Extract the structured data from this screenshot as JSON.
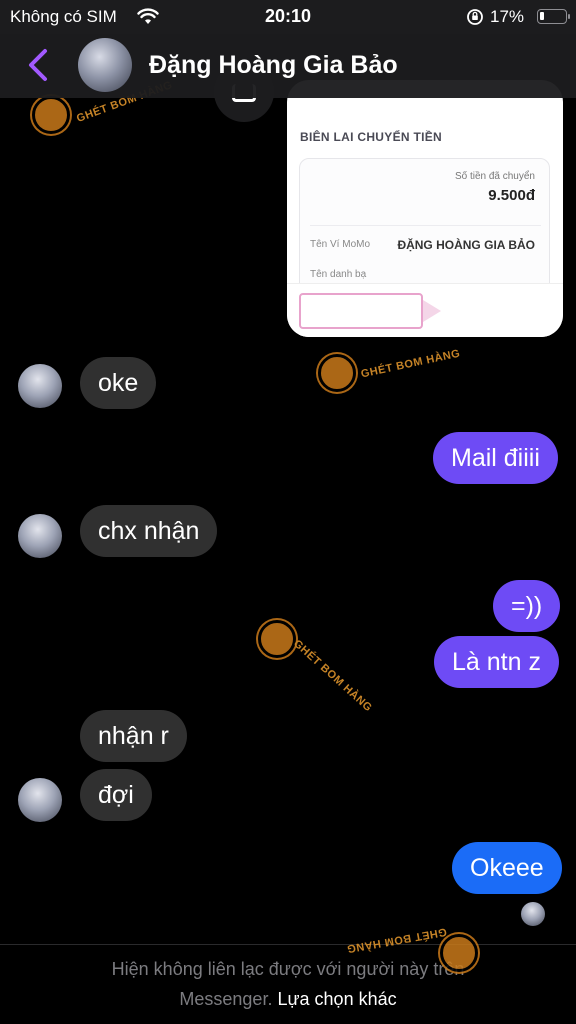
{
  "status_bar": {
    "carrier": "Không có SIM",
    "time": "20:10",
    "battery_pct": "17%",
    "battery_level": 0.17
  },
  "header": {
    "title": "Đặng Hoàng Gia Bảo",
    "back_icon": "chevron-left-icon",
    "accent_color": "#a259ff"
  },
  "shared_receipt": {
    "heading": "BIÊN LAI CHUYỂN TIỀN",
    "amount_label": "Số tiền đã chuyển",
    "amount": "9.500đ",
    "wallet_label": "Tên Ví MoMo",
    "wallet_name": "ĐẶNG HOÀNG GIA BẢO",
    "contact_label": "Tên danh bạ"
  },
  "messages": [
    {
      "side": "in",
      "text": "oke"
    },
    {
      "side": "out",
      "text": "Mail điiii"
    },
    {
      "side": "in",
      "text": "chx nhận"
    },
    {
      "side": "out",
      "text": "=))"
    },
    {
      "side": "out",
      "text": "Là ntn z"
    },
    {
      "side": "in",
      "text": "nhận r"
    },
    {
      "side": "in",
      "text": "đợi"
    },
    {
      "side": "out",
      "text": "Okeee"
    }
  ],
  "watermark": {
    "text": "GHÉT BOM HÀNG"
  },
  "footer": {
    "notice": "Hiện không liên lạc được với người này trên",
    "notice_line2": "Messenger.",
    "action": "Lựa chọn khác"
  },
  "colors": {
    "outgoing_bubble": "#6e4bf5",
    "outgoing_bubble_latest": "#1b6cf7",
    "incoming_bubble": "#303030"
  }
}
